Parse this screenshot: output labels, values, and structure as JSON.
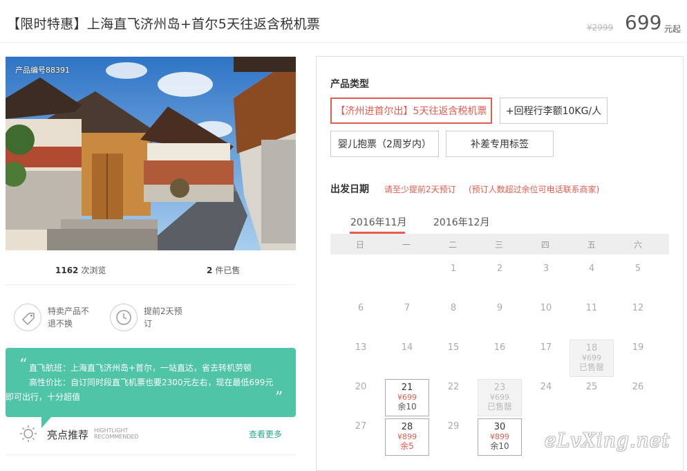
{
  "header": {
    "title": "【限时特惠】上海直飞济州岛+首尔5天往返含税机票",
    "price_old": "¥2999",
    "price": "699",
    "price_unit": "元起"
  },
  "gallery": {
    "product_id": "产品编号88391"
  },
  "stats": {
    "views_count": "1162",
    "views_label": "次浏览",
    "sold_count": "2",
    "sold_label": "件已售"
  },
  "features": [
    {
      "icon": "tag-icon",
      "line1": "特卖产品不",
      "line2": "退不换"
    },
    {
      "icon": "clock-icon",
      "line1": "提前2天预",
      "line2": "订"
    }
  ],
  "recommend": {
    "lines": [
      "直飞航班：上海直飞济州岛+首尔，一站直达，省去转机劳顿",
      "高性价比：自订同时段直飞机票也要2300元左右，现在最低699元",
      "即可出行，十分超值"
    ],
    "title": "亮点推荐",
    "en1": "HIGHTLIGHT",
    "en2": "RECOMMENDED",
    "more": "查看更多"
  },
  "booking": {
    "type_label": "产品类型",
    "options": [
      "【济州进首尔出】5天往返含税机票",
      "+回程行李额10KG/人",
      "婴儿抱票（2周岁内）",
      "补差专用标签"
    ],
    "date_label": "出发日期",
    "hint1": "请至少提前2天预订",
    "hint2": "(预订人数超过余位可电话联系商家)",
    "tabs": [
      "2016年11月",
      "2016年12月"
    ],
    "weekdays": [
      "日",
      "一",
      "二",
      "三",
      "四",
      "五",
      "六"
    ],
    "days": {
      "d1": "1",
      "d2": "2",
      "d3": "3",
      "d4": "4",
      "d5": "5",
      "d6": "6",
      "d7": "7",
      "d8": "8",
      "d9": "9",
      "d10": "10",
      "d11": "11",
      "d12": "12",
      "d13": "13",
      "d14": "14",
      "d15": "15",
      "d16": "16",
      "d17": "17",
      "d18": "18",
      "d19": "19",
      "d20": "20",
      "d21": "21",
      "d22": "22",
      "d23": "23",
      "d24": "24",
      "d25": "25",
      "d26": "26",
      "d27": "27",
      "d28": "28",
      "d29": "29",
      "d30": "30"
    },
    "day18": {
      "price": "¥699",
      "status": "已售罄"
    },
    "day21": {
      "price": "¥699",
      "status": "余10"
    },
    "day23": {
      "price": "¥699",
      "status": "已售罄"
    },
    "day28": {
      "price": "¥899",
      "status": "余5"
    },
    "day30": {
      "price": "¥899",
      "status": "余10"
    }
  },
  "watermark": "eLvXing.net",
  "colors": {
    "accent": "#e45c4e",
    "green": "#4fc4a6"
  }
}
